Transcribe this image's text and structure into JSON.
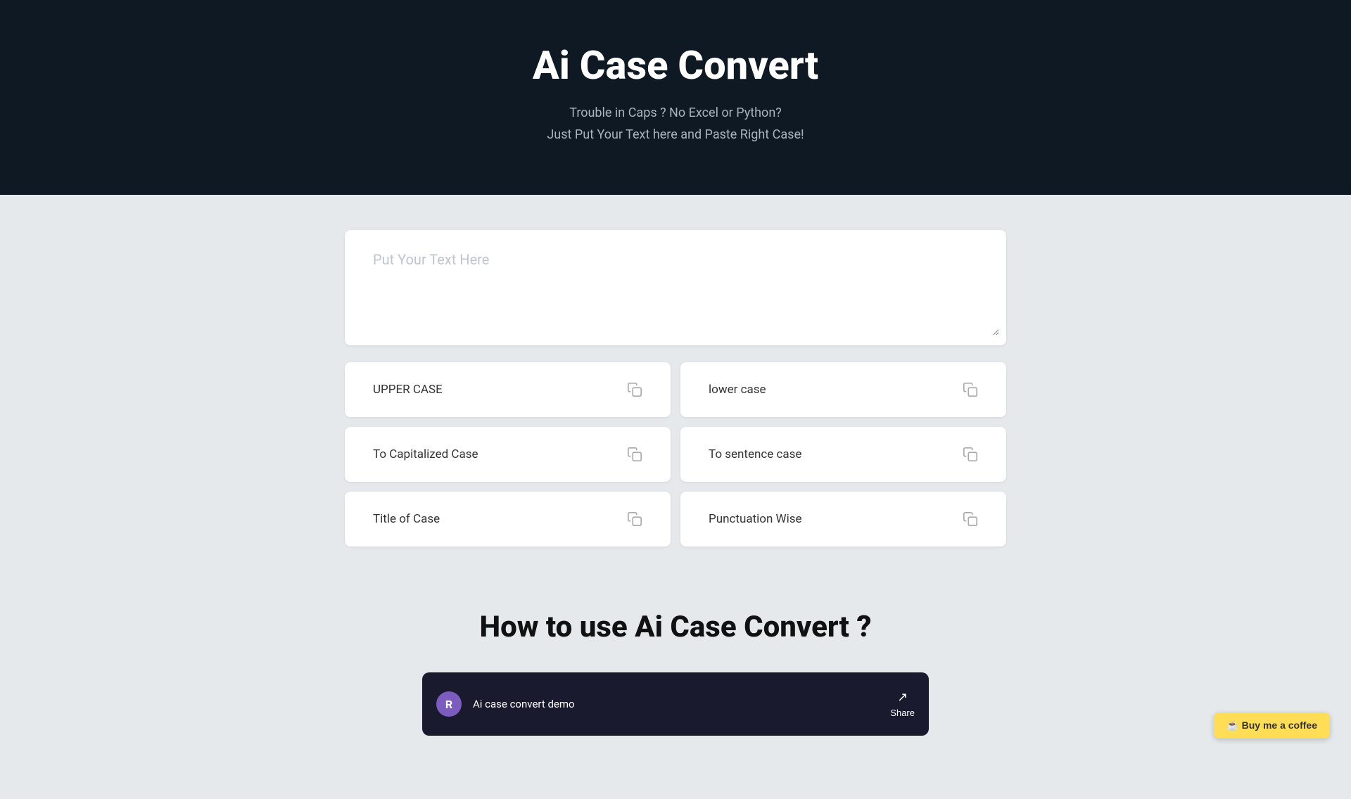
{
  "header": {
    "title": "Ai Case Convert",
    "subtitle_line1": "Trouble in Caps ? No Excel or Python?",
    "subtitle_line2": "Just Put Your Text here and Paste Right Case!"
  },
  "textarea": {
    "placeholder": "Put Your Text Here"
  },
  "case_cards": [
    {
      "id": "upper-case",
      "label": "UPPER CASE"
    },
    {
      "id": "lower-case",
      "label": "lower case"
    },
    {
      "id": "capitalized-case",
      "label": "To Capitalized Case"
    },
    {
      "id": "sentence-case",
      "label": "To sentence case"
    },
    {
      "id": "title-case",
      "label": "Title of Case"
    },
    {
      "id": "punctuation-wise",
      "label": "Punctuation Wise"
    }
  ],
  "how_to": {
    "heading": "How to use Ai Case Convert ?",
    "video_channel": "R",
    "video_title": "Ai case convert demo",
    "share_label": "Share"
  },
  "buy_coffee": {
    "label": "☕ Buy me a coffee"
  }
}
